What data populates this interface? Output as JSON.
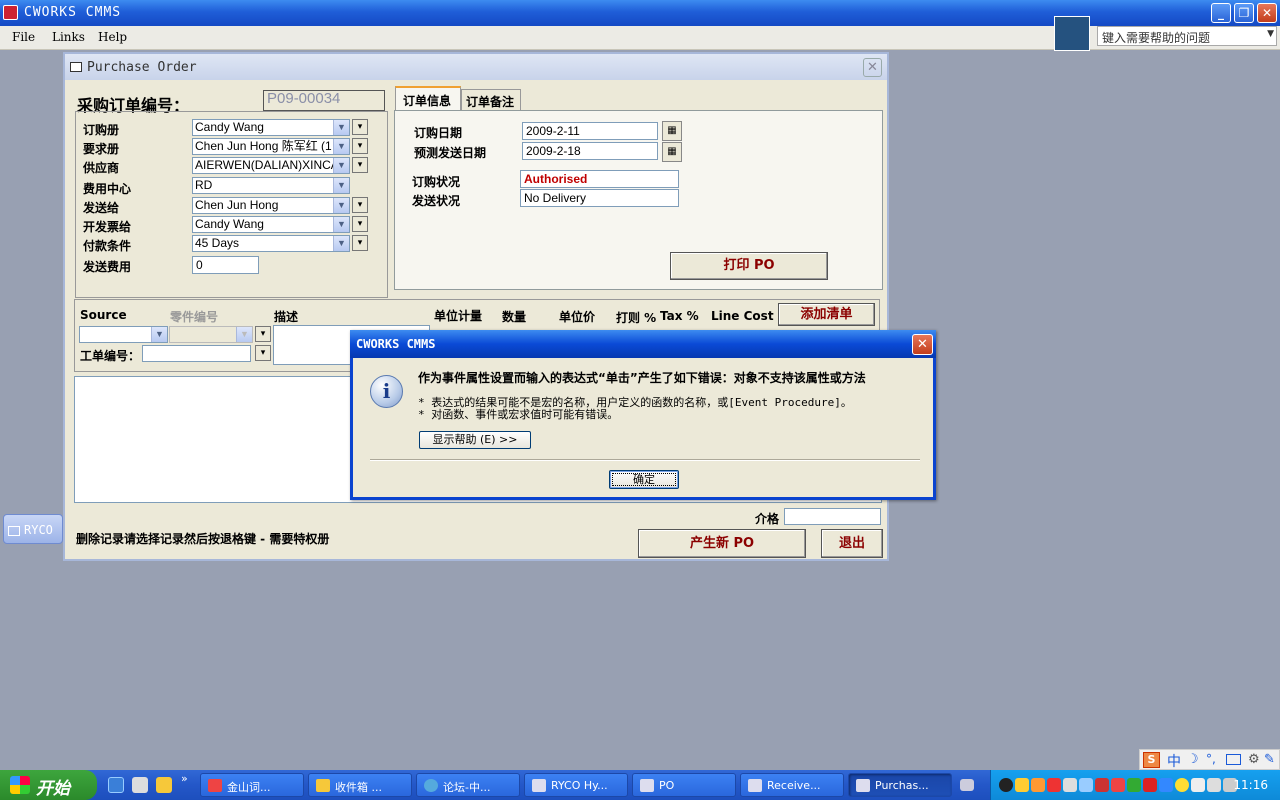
{
  "app": {
    "title": "CWORKS CMMS",
    "menus": [
      "File",
      "Links",
      "Help"
    ],
    "help_placeholder": "键入需要帮助的问题"
  },
  "side_item": {
    "label": "RYCO"
  },
  "po_window": {
    "title": "Purchase Order",
    "order_no_label": "采购订单编号：",
    "order_no": "P09-00034",
    "fields": [
      {
        "label": "订购册",
        "value": "Candy Wang"
      },
      {
        "label": "要求册",
        "value": "Chen Jun Hong 陈军红 (1"
      },
      {
        "label": "供应商",
        "value": "AIERWEN(DALIAN)XINCA"
      },
      {
        "label": "费用中心",
        "value": "RD"
      },
      {
        "label": "发送给",
        "value": "Chen Jun Hong"
      },
      {
        "label": "开发票给",
        "value": "Candy Wang"
      },
      {
        "label": "付款条件",
        "value": "45 Days"
      }
    ],
    "shipping_cost_label": "发送费用",
    "shipping_cost": "0",
    "tabs": [
      "订单信息",
      "订单备注"
    ],
    "order_date_label": "订购日期",
    "order_date": "2009-2-11",
    "expected_date_label": "预测发送日期",
    "expected_date": "2009-2-18",
    "order_status_label": "订购状况",
    "order_status": "Authorised",
    "delivery_status_label": "发送状况",
    "delivery_status": "No Delivery",
    "print_button": "打印 PO",
    "line_headers": {
      "source": "Source",
      "part_no": "零件编号",
      "description": "描述",
      "unit": "单位计量",
      "qty": "数量",
      "unit_price": "单位价",
      "discount": "打则 %",
      "tax": "Tax %",
      "line_cost": "Line Cost"
    },
    "add_line_button": "添加清单",
    "work_order_label": "工单编号：",
    "price_label": "介格",
    "delete_hint": "删除记录请选择记录然后按退格键 - 需要特权册",
    "new_po_button": "产生新 PO",
    "exit_button": "退出"
  },
  "dialog": {
    "title": "CWORKS CMMS",
    "message": "作为事件属性设置而输入的表达式“单击”产生了如下错误：对象不支持该属性或方法",
    "detail_1": "* 表达式的结果可能不是宏的名称，用户定义的函数的名称，或[Event Procedure]。",
    "detail_2": "* 对函数、事件或宏求值时可能有错误。",
    "help_button": "显示帮助 (E) >>",
    "ok_button": "确定"
  },
  "taskbar": {
    "start": "开始",
    "buttons": [
      "金山词...",
      "收件箱 ...",
      "论坛-中...",
      "RYCO Hy...",
      "PO",
      "Receive...",
      "Purchas..."
    ],
    "clock": "11:16"
  },
  "ime": {
    "label": "中"
  }
}
